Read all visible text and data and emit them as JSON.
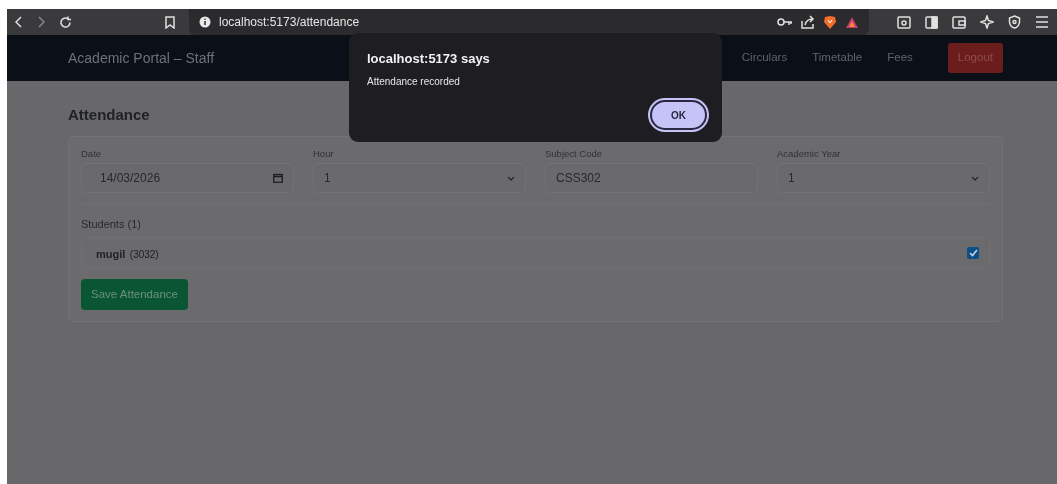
{
  "browser": {
    "url": "localhost:5173/attendance"
  },
  "navbar": {
    "brand": "Academic Portal – Staff",
    "links": [
      "Circulars",
      "Timetable",
      "Fees"
    ],
    "logout": "Logout"
  },
  "page_title": "Attendance",
  "fields": [
    {
      "label": "Date",
      "value": "14/03/2026",
      "kind": "date"
    },
    {
      "label": "Hour",
      "value": "1",
      "kind": "select"
    },
    {
      "label": "Subject Code",
      "value": "CSS302",
      "kind": "text"
    },
    {
      "label": "Academic Year",
      "value": "1",
      "kind": "select"
    }
  ],
  "students_heading": "Students (1)",
  "students": [
    {
      "name": "mugil",
      "roll": "(3032)",
      "checked": true
    }
  ],
  "save_button": "Save Attendance",
  "dialog": {
    "title": "localhost:5173 says",
    "message": "Attendance recorded",
    "button": "OK"
  }
}
